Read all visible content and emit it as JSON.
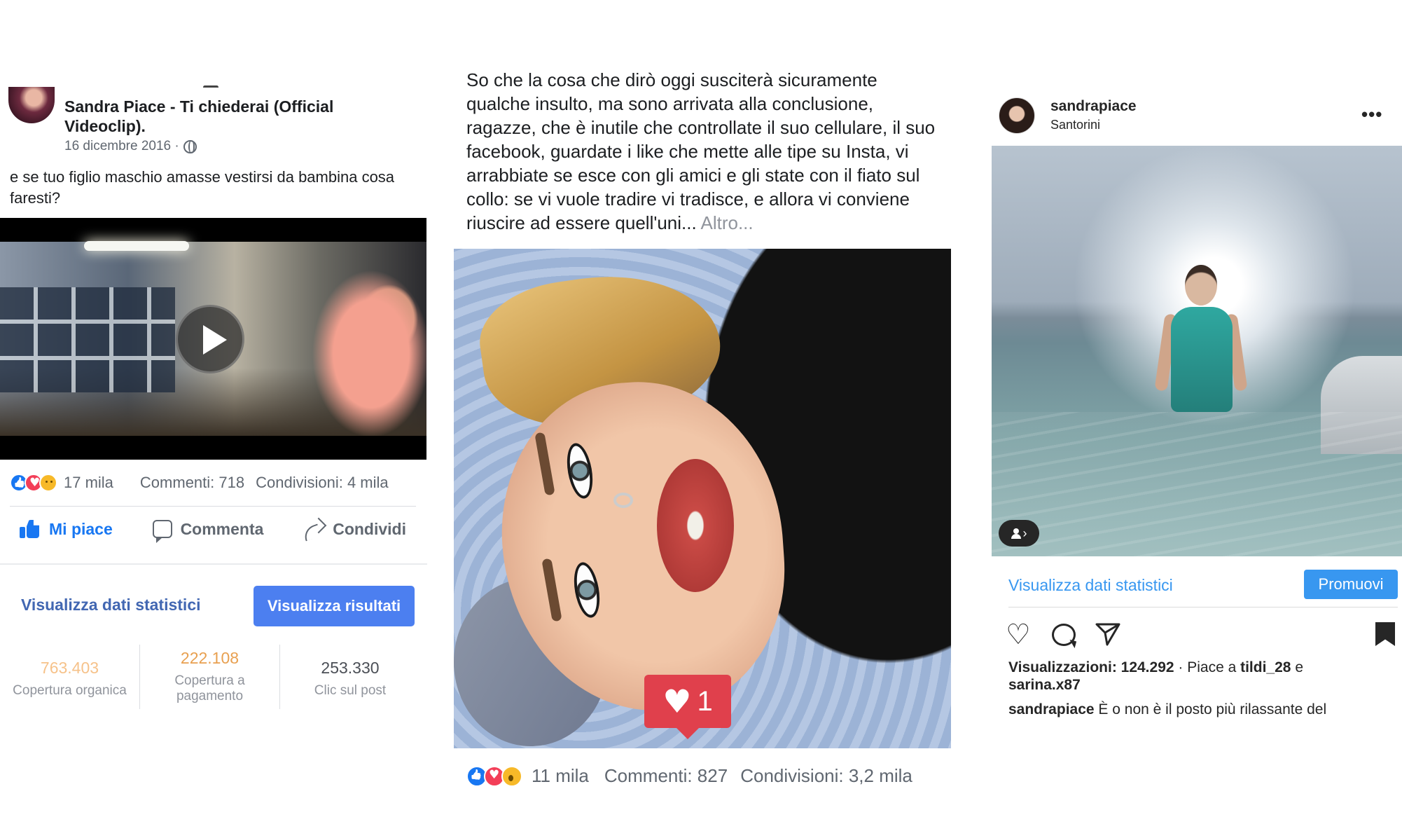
{
  "fb_video_post": {
    "title": "Sandra Piace - Ti chiederai (Official Videoclip)",
    "title_suffix": ".",
    "date": "16 dicembre 2016 ·",
    "text": "e se tuo figlio maschio amasse vestirsi da bambina cosa faresti?",
    "reactions_count": "17 mila",
    "comments": "Commenti: 718",
    "shares": "Condivisioni: 4 mila",
    "actions": {
      "like": "Mi piace",
      "comment": "Commenta",
      "share": "Condividi"
    },
    "insights_link": "Visualizza dati statistici",
    "results_button": "Visualizza risultati",
    "kpis": {
      "organic": {
        "value": "763.403",
        "label": "Copertura organica"
      },
      "paid": {
        "value": "222.108",
        "label": "Copertura a pagamento"
      },
      "clicks": {
        "value": "253.330",
        "label": "Clic sul post"
      }
    },
    "colors": {
      "link": "#4267b2",
      "button": "#4c7ff0",
      "like_active": "#1877f2"
    }
  },
  "fb_photo_post": {
    "text": "So che la cosa che dirò oggi susciterà sicuramente qualche insulto, ma sono arrivata alla conclusione, ragazze, che è inutile che controllate il suo cellulare, il suo facebook, guardate i like che mette alle tipe su Insta, vi arrabbiate se esce con gli amici e gli state con il fiato sul collo: se vi vuole tradire vi tradisce, e allora vi conviene riuscire ad essere quell'uni...",
    "more": "Altro...",
    "like_badge_count": "1",
    "reactions_count": "11 mila",
    "comments": "Commenti: 827",
    "shares": "Condivisioni: 3,2 mila"
  },
  "instagram_post": {
    "username": "sandrapiace",
    "location": "Santorini",
    "more_icon": "•••",
    "stats_link": "Visualizza dati statistici",
    "promote_button": "Promuovi",
    "views": "Visualizzazioni: 124.292",
    "likes_prefix": " · Piace a ",
    "liker1": "tildi_28",
    "likes_and": " e",
    "liker2": "sarina.x87",
    "caption_user": "sandrapiace",
    "caption_text": " È o non è il posto più rilassante del",
    "colors": {
      "link": "#3897f0",
      "button": "#3897f0"
    }
  }
}
